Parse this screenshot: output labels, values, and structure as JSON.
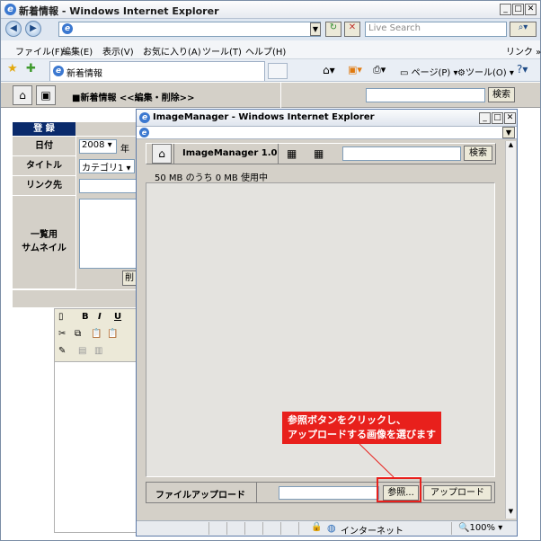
{
  "browser": {
    "title": "新着情報 - Windows Internet Explorer",
    "address": "",
    "search_placeholder": "Live Search",
    "menu": [
      "ファイル(F)",
      "編集(E)",
      "表示(V)",
      "お気に入り(A)",
      "ツール(T)",
      "ヘルプ(H)"
    ],
    "links_label": "リンク »",
    "tab_label": "新着情報",
    "toolbar_right": [
      "ページ(P)",
      "ツール(O)"
    ]
  },
  "page": {
    "heading": "■新着情報 <<編集・削除>>",
    "search_button": "検索",
    "form_header": "登 録",
    "rows": [
      "日付",
      "タイトル",
      "リンク先",
      "一覧用\nサムネイル"
    ],
    "year_value": "2008",
    "year_suffix": "年",
    "category_value": "カテゴリ1",
    "delete_button": "削"
  },
  "popup": {
    "title": "ImageManager - Windows Internet Explorer",
    "app_name": "ImageManager 1.0",
    "search_button": "検索",
    "usage": "50 MB のうち 0 MB 使用中",
    "upload_label": "ファイルアップロード",
    "browse_button": "参照...",
    "upload_button": "アップロード",
    "status_zone": "インターネット",
    "zoom": "100%"
  },
  "callout": {
    "line1": "参照ボタンをクリックし、",
    "line2": "アップロードする画像を選びます"
  },
  "colors": {
    "accent": "#e8201c",
    "navy": "#0a2a6b",
    "panel": "#d4d0c8"
  }
}
